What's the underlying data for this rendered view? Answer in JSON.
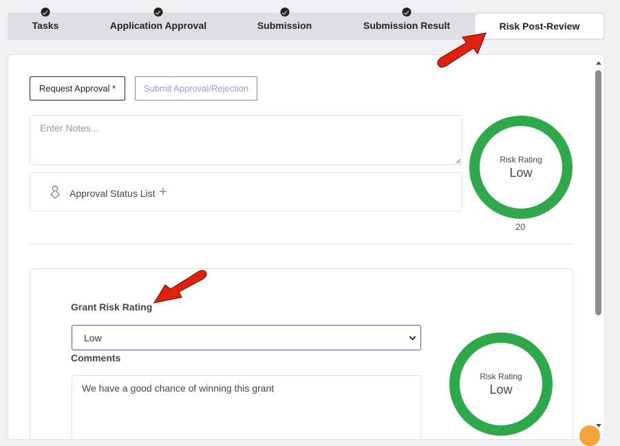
{
  "tabs": [
    {
      "label": "Tasks",
      "done": true
    },
    {
      "label": "Application Approval",
      "done": true
    },
    {
      "label": "Submission",
      "done": true
    },
    {
      "label": "Submission Result",
      "done": true
    },
    {
      "label": "Risk Post-Review",
      "done": false,
      "active": true
    }
  ],
  "actions": {
    "request_label": "Request Approval *",
    "submit_label": "Submit Approval/Rejection"
  },
  "notes": {
    "placeholder": "Enter Notes...",
    "value": ""
  },
  "approval_status": {
    "label": "Approval Status List",
    "icon": "person-icon",
    "add_icon": "plus-icon"
  },
  "risk_summary": {
    "title": "Risk Rating",
    "value": "Low",
    "score": "20",
    "color": "#2ea84a"
  },
  "grant_form": {
    "grant_label": "Grant Risk Rating",
    "selected": "Low",
    "comments_label": "Comments",
    "comments_value": "We have a good chance of winning this grant"
  },
  "grant_risk": {
    "title": "Risk Rating",
    "value": "Low",
    "color": "#2ea84a"
  },
  "colors": {
    "accent": "#5a4fb0",
    "annotation_arrow": "#e0210f",
    "submit_text": "#a594e0"
  }
}
